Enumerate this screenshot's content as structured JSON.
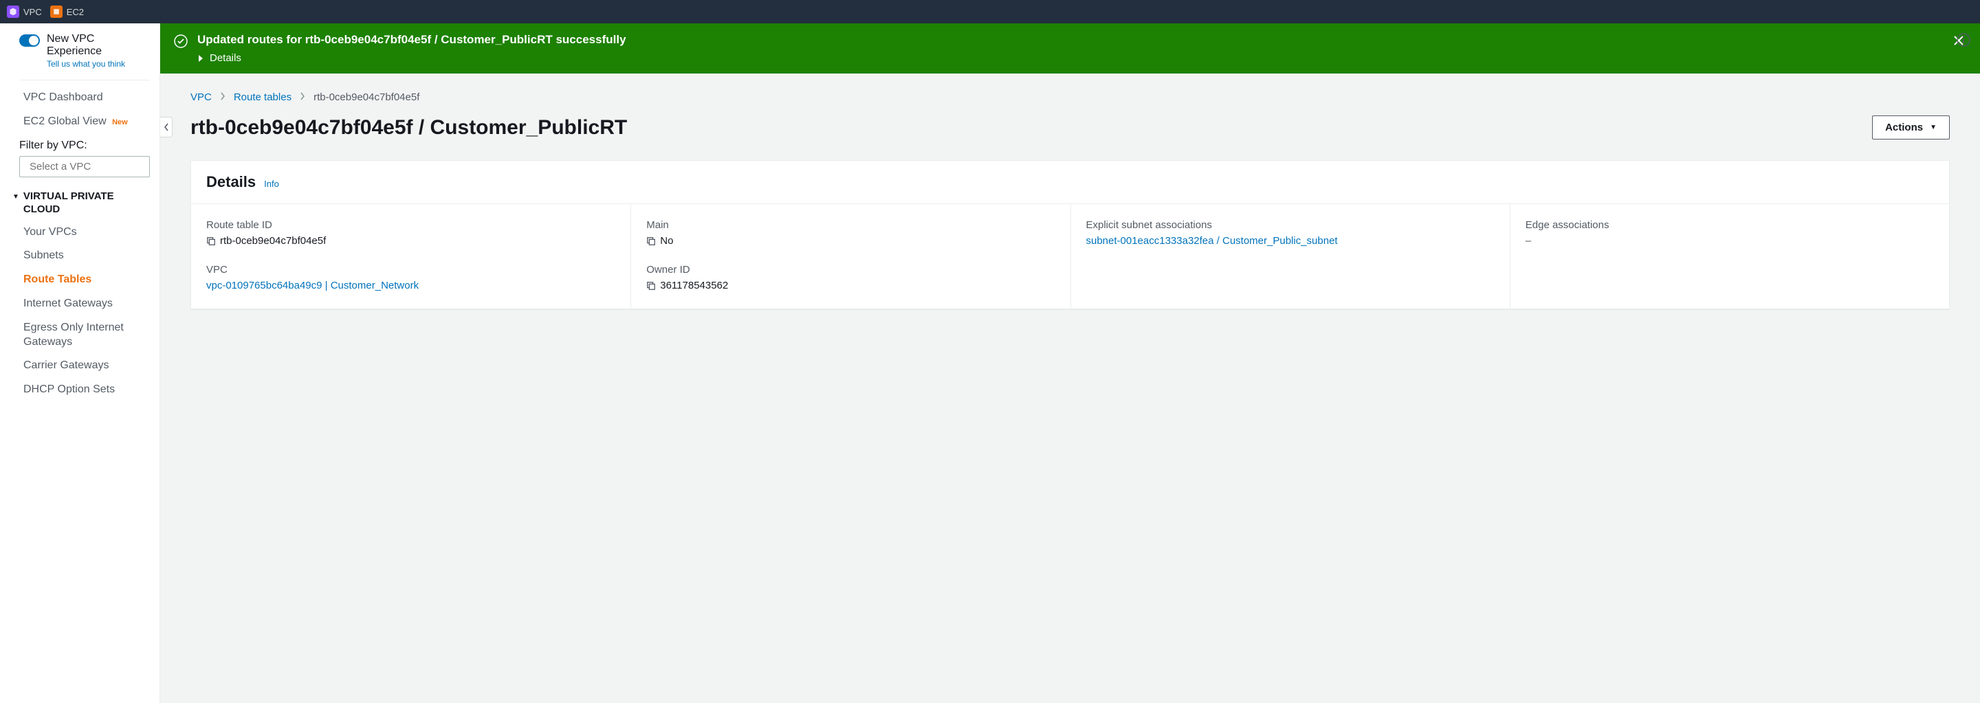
{
  "topbar": {
    "vpc": "VPC",
    "ec2": "EC2"
  },
  "sidebar": {
    "experience_title": "New VPC Experience",
    "tell_us": "Tell us what you think",
    "filter_label": "Filter by VPC:",
    "filter_placeholder": "Select a VPC",
    "section": "VIRTUAL PRIVATE CLOUD",
    "new_badge": "New",
    "items": {
      "dashboard": "VPC Dashboard",
      "ec2global": "EC2 Global View",
      "yourvpcs": "Your VPCs",
      "subnets": "Subnets",
      "rt": "Route Tables",
      "igw": "Internet Gateways",
      "eigw": "Egress Only Internet Gateways",
      "cgw": "Carrier Gateways",
      "dhcp": "DHCP Option Sets"
    }
  },
  "flash": {
    "message": "Updated routes for rtb-0ceb9e04c7bf04e5f / Customer_PublicRT successfully",
    "details": "Details"
  },
  "breadcrumb": {
    "vpc": "VPC",
    "rt": "Route tables",
    "current": "rtb-0ceb9e04c7bf04e5f"
  },
  "page": {
    "title": "rtb-0ceb9e04c7bf04e5f / Customer_PublicRT",
    "actions": "Actions"
  },
  "panel": {
    "title": "Details",
    "info": "Info",
    "route_table_id": {
      "label": "Route table ID",
      "value": "rtb-0ceb9e04c7bf04e5f"
    },
    "main": {
      "label": "Main",
      "value": "No"
    },
    "explicit": {
      "label": "Explicit subnet associations",
      "value": "subnet-001eacc1333a32fea / Customer_Public_subnet"
    },
    "edge": {
      "label": "Edge associations",
      "value": "–"
    },
    "vpc": {
      "label": "VPC",
      "value": "vpc-0109765bc64ba49c9 | Customer_Network"
    },
    "owner": {
      "label": "Owner ID",
      "value": "361178543562"
    }
  }
}
